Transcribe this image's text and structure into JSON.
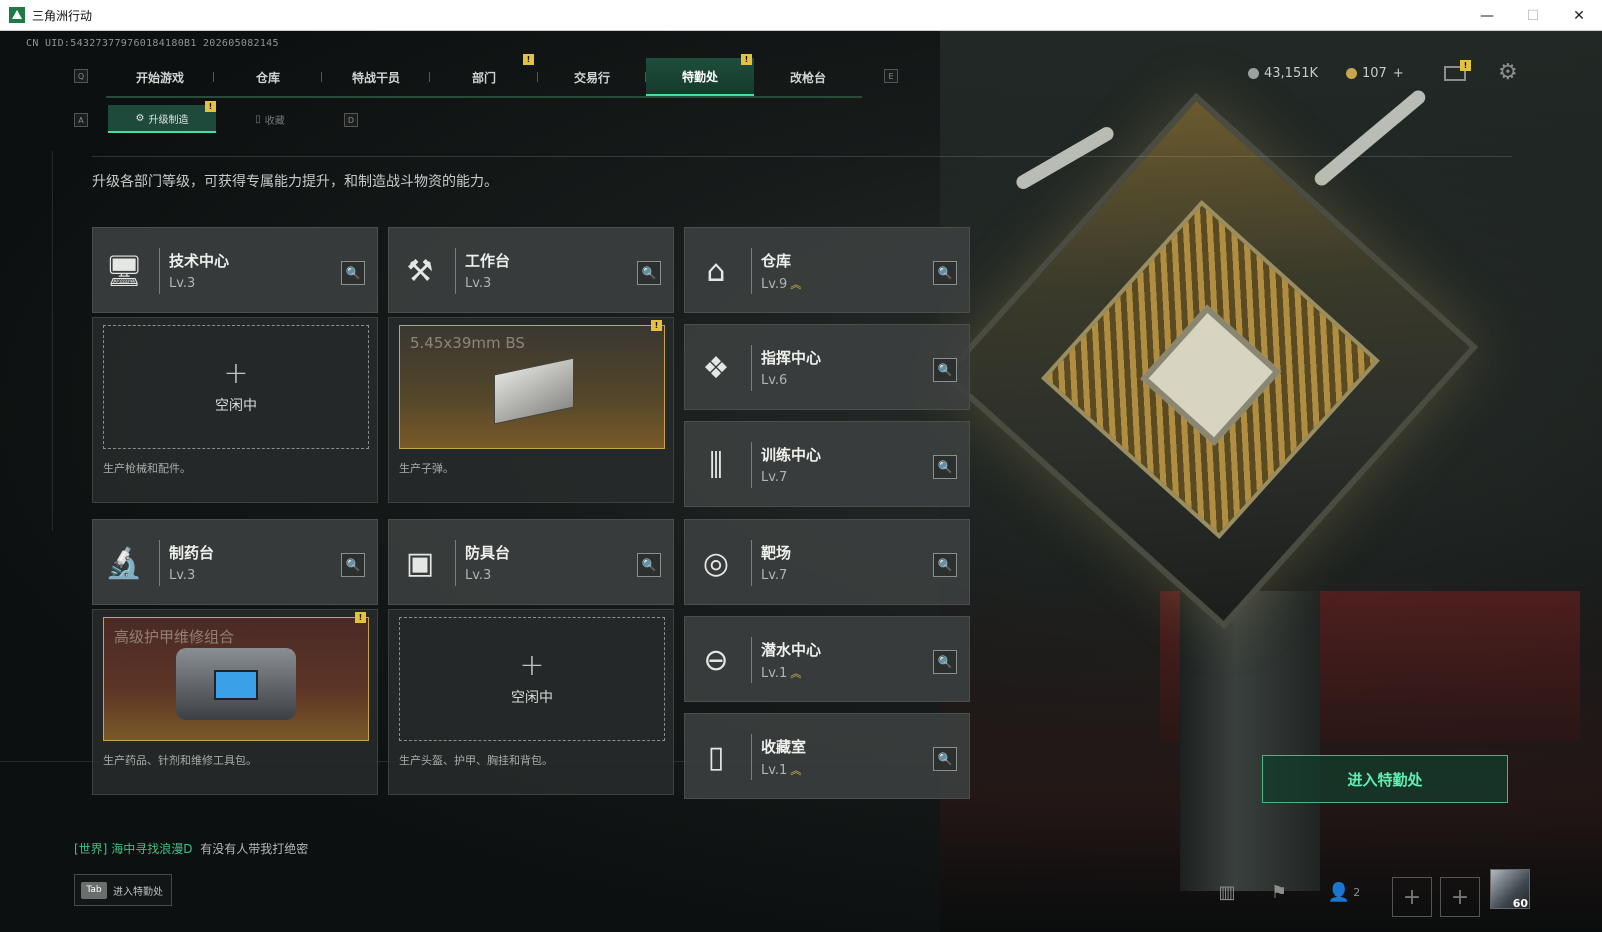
{
  "window": {
    "title": "三角洲行动",
    "controls": [
      "—",
      "☐",
      "✕"
    ]
  },
  "uid": "CN UID:543273779760184180B1 202605082145",
  "topnav": {
    "left_key": "Q",
    "right_key": "E",
    "tabs": [
      {
        "label": "开始游戏"
      },
      {
        "label": "仓库"
      },
      {
        "label": "特战干员"
      },
      {
        "label": "部门",
        "badge": "!"
      },
      {
        "label": "交易行"
      },
      {
        "label": "特勤处",
        "badge": "!",
        "active": true
      },
      {
        "label": "改枪台"
      }
    ]
  },
  "currency": {
    "coins": "43,151K",
    "tickets": "107",
    "tickets_plus": "+"
  },
  "mail_badge": "!",
  "subnav": {
    "left_key": "A",
    "right_key": "D",
    "tabs": [
      {
        "label": "升级制造",
        "badge": "!",
        "active": true
      },
      {
        "label": "收藏"
      }
    ]
  },
  "description": "升级各部门等级，可获得专属能力提升，和制造战斗物资的能力。",
  "facilities": {
    "tech_center": {
      "name": "技术中心",
      "level": "Lv.3",
      "icon": "monitor-icon"
    },
    "workbench": {
      "name": "工作台",
      "level": "Lv.3",
      "icon": "tools-icon"
    },
    "warehouse": {
      "name": "仓库",
      "level": "Lv.9",
      "upgrade": "︽",
      "icon": "vault-icon"
    },
    "command_center": {
      "name": "指挥中心",
      "level": "Lv.6",
      "icon": "command-icon"
    },
    "training_center": {
      "name": "训练中心",
      "level": "Lv.7",
      "icon": "dumbbell-icon"
    },
    "pharmacy": {
      "name": "制药台",
      "level": "Lv.3",
      "icon": "microscope-icon"
    },
    "armor_bench": {
      "name": "防具台",
      "level": "Lv.3",
      "icon": "cubes-icon"
    },
    "range": {
      "name": "靶场",
      "level": "Lv.7",
      "icon": "target-icon"
    },
    "diving_center": {
      "name": "潜水中心",
      "level": "Lv.1",
      "upgrade": "︽",
      "icon": "diving-mask-icon"
    },
    "collection_room": {
      "name": "收藏室",
      "level": "Lv.1",
      "upgrade": "︽",
      "icon": "collection-icon"
    }
  },
  "production": {
    "tech_center": {
      "status": "空闲中",
      "plus": "+",
      "desc": "生产枪械和配件。"
    },
    "workbench": {
      "item": "5.45x39mm BS",
      "badge": "!",
      "desc": "生产子弹。"
    },
    "pharmacy": {
      "item": "高级护甲维修组合",
      "badge": "!",
      "desc": "生产药品、针剂和维修工具包。"
    },
    "armor_bench": {
      "status": "空闲中",
      "plus": "+",
      "desc": "生产头盔、护甲、胸挂和背包。"
    }
  },
  "enter_button": "进入特勤处",
  "chat": {
    "channel": "[世界]",
    "user": "海中寻找浪漫D",
    "message": "有没有人带我打绝密"
  },
  "tab_hint": {
    "key": "Tab",
    "label": "进入特勤处"
  },
  "bottom_bar": {
    "friends_count": "2",
    "avatar_level": "60"
  },
  "colors": {
    "accent": "#3fe0a0",
    "badge": "#e4c240",
    "upgrade": "#e5c548"
  }
}
